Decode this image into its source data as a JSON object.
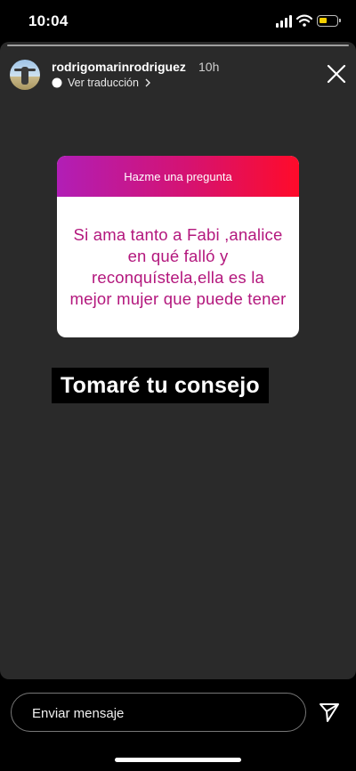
{
  "status_bar": {
    "time": "10:04",
    "signal_icon": "cellular-signal-icon",
    "wifi_icon": "wifi-icon",
    "battery_icon": "battery-low-icon",
    "battery_color": "#f5d000"
  },
  "story": {
    "username": "rodrigomarinrodriguez",
    "time_ago": "10h",
    "translate_label": "Ver traducción",
    "background_color": "#2a2a2a"
  },
  "question_sticker": {
    "header": "Hazme una pregunta",
    "question": "Si ama tanto a Fabi ,analice en qué falló y reconquístela,ella es la mejor mujer que puede tener",
    "question_color": "#b3177d"
  },
  "reply_text": "Tomaré tu consejo",
  "message_bar": {
    "placeholder": "Enviar mensaje",
    "send_icon": "send-paper-plane-icon"
  }
}
